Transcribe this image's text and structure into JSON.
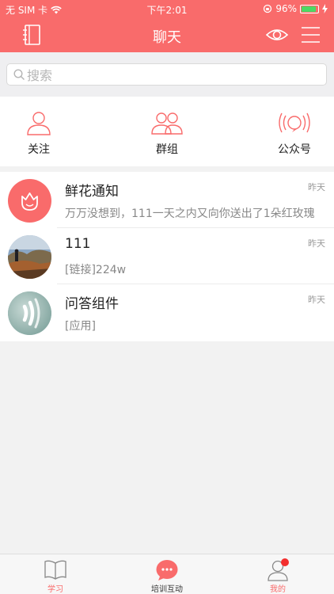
{
  "status_bar": {
    "carrier": "无 SIM 卡",
    "time": "下午2:01",
    "battery": "96%"
  },
  "header": {
    "title": "聊天"
  },
  "search": {
    "placeholder": "搜索"
  },
  "quick_actions": [
    {
      "label": "关注",
      "icon": "person-icon"
    },
    {
      "label": "群组",
      "icon": "group-icon"
    },
    {
      "label": "公众号",
      "icon": "broadcast-icon"
    }
  ],
  "conversations": [
    {
      "title": "鲜花通知",
      "subtitle": "万万没想到，111一天之内又向你送出了1朵红玫瑰",
      "time": "昨天",
      "avatar": "rose-icon"
    },
    {
      "title": "111",
      "subtitle": "[链接]224w",
      "time": "昨天",
      "avatar": "user-photo"
    },
    {
      "title": "问答组件",
      "subtitle": "[应用]",
      "time": "昨天",
      "avatar": "sound-wave-icon"
    }
  ],
  "tabbar": {
    "items": [
      {
        "label": "学习",
        "icon": "book-icon"
      },
      {
        "label": "培训互动",
        "icon": "chat-bubble-icon"
      },
      {
        "label": "我的",
        "icon": "user-icon"
      }
    ]
  },
  "colors": {
    "accent": "#f96b6b",
    "active_tab": "#f96b6b"
  }
}
